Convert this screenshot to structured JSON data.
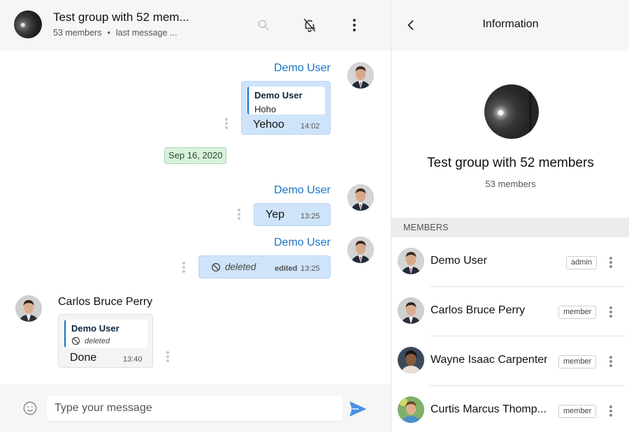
{
  "chat_header": {
    "title": "Test group with 52 mem...",
    "members": "53 members",
    "separator": "•",
    "last_message": "last message ..."
  },
  "messages": [
    {
      "sender": "Demo User",
      "reply_to_name": "Demo User",
      "reply_to_text": "Hoho",
      "text": "Yehoo",
      "time": "14:02"
    },
    {
      "date": "Sep 16, 2020"
    },
    {
      "sender": "Demo User",
      "text": "Yep",
      "time": "13:25"
    },
    {
      "sender": "Demo User",
      "deleted_text": "deleted",
      "edited_label": "edited",
      "time": "13:25"
    },
    {
      "sender": "Carlos Bruce Perry",
      "reply_to_name": "Demo User",
      "reply_to_text": "deleted",
      "text": "Done",
      "time": "13:40"
    }
  ],
  "composer": {
    "placeholder": "Type your message"
  },
  "info_panel": {
    "title": "Information",
    "group_name": "Test group with 52 members",
    "member_count": "53 members",
    "members_section_label": "MEMBERS",
    "members": [
      {
        "name": "Demo User",
        "role": "admin"
      },
      {
        "name": "Carlos Bruce Perry",
        "role": "member"
      },
      {
        "name": "Wayne Isaac Carpenter",
        "role": "member"
      },
      {
        "name": "Curtis Marcus Thomp...",
        "role": "member"
      }
    ]
  },
  "colors": {
    "accent_blue": "#1a73c8",
    "outgoing_bubble": "#cfe4fb",
    "date_chip": "#d9f1dc",
    "header_bg": "#f6f6f6",
    "send_icon": "#4a90e2"
  },
  "icons": [
    "search-icon",
    "bell-off-icon",
    "more-vertical-icon",
    "back-chevron-icon",
    "smiley-icon",
    "send-icon",
    "blocked-icon"
  ]
}
